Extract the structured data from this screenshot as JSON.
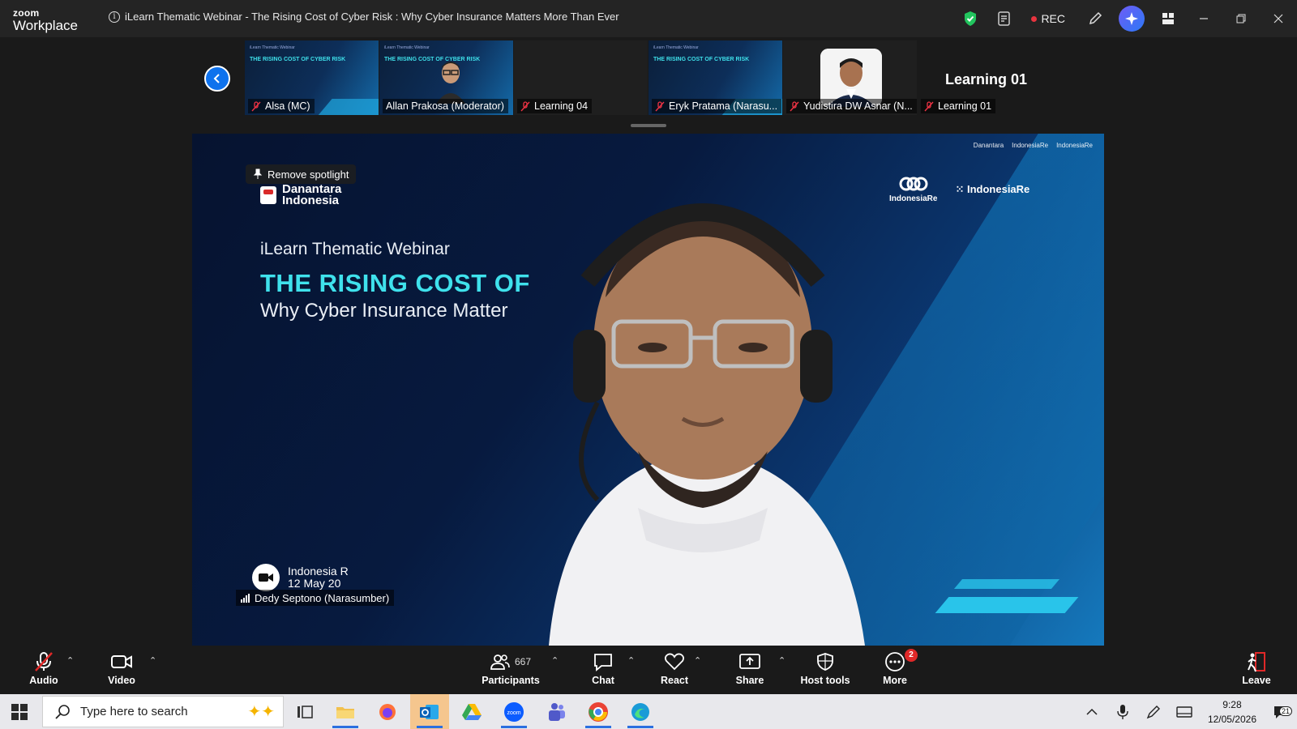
{
  "titlebar": {
    "brand_small": "zoom",
    "brand_large": "Workplace",
    "meeting_title": "iLearn Thematic Webinar - The Rising Cost of Cyber Risk : Why Cyber Insurance Matters More Than Ever",
    "rec_label": "REC"
  },
  "gallery": {
    "tiles": [
      {
        "label": "Alsa (MC)"
      },
      {
        "label": "Allan Prakosa (Moderator)"
      },
      {
        "label": "Learning 04"
      },
      {
        "label": "Eryk Pratama (Narasu..."
      },
      {
        "label": "Yudistira DW Asnar (N..."
      },
      {
        "label": "Learning 01"
      }
    ],
    "big_name": "Learning 01"
  },
  "main": {
    "spotlight_label": "Remove spotlight",
    "org_line1": "Danantara",
    "org_line2": "Indonesia",
    "slide_pre": "iLearn Thematic Webinar",
    "slide_head": "THE RISING COST OF",
    "slide_sub": "Why Cyber Insurance Matter",
    "logo_a": "IndonesiaRe",
    "logo_b": "IndonesiaRe",
    "footer_line1": "Indonesia R",
    "footer_line2": "12 May 20",
    "speaker_name": "Dedy Septono (Narasumber)"
  },
  "controls": {
    "audio": "Audio",
    "video": "Video",
    "participants": "Participants",
    "participant_count": "667",
    "chat": "Chat",
    "react": "React",
    "share": "Share",
    "host_tools": "Host tools",
    "more": "More",
    "more_badge": "2",
    "leave": "Leave"
  },
  "taskbar": {
    "search_placeholder": "Type here to search",
    "time": "9:28",
    "date": "12/05/2026",
    "notif_count": "21"
  },
  "colors": {
    "accent_blue": "#0e72ed",
    "rec_red": "#e8343f",
    "slide_cyan": "#3fe1ec"
  }
}
